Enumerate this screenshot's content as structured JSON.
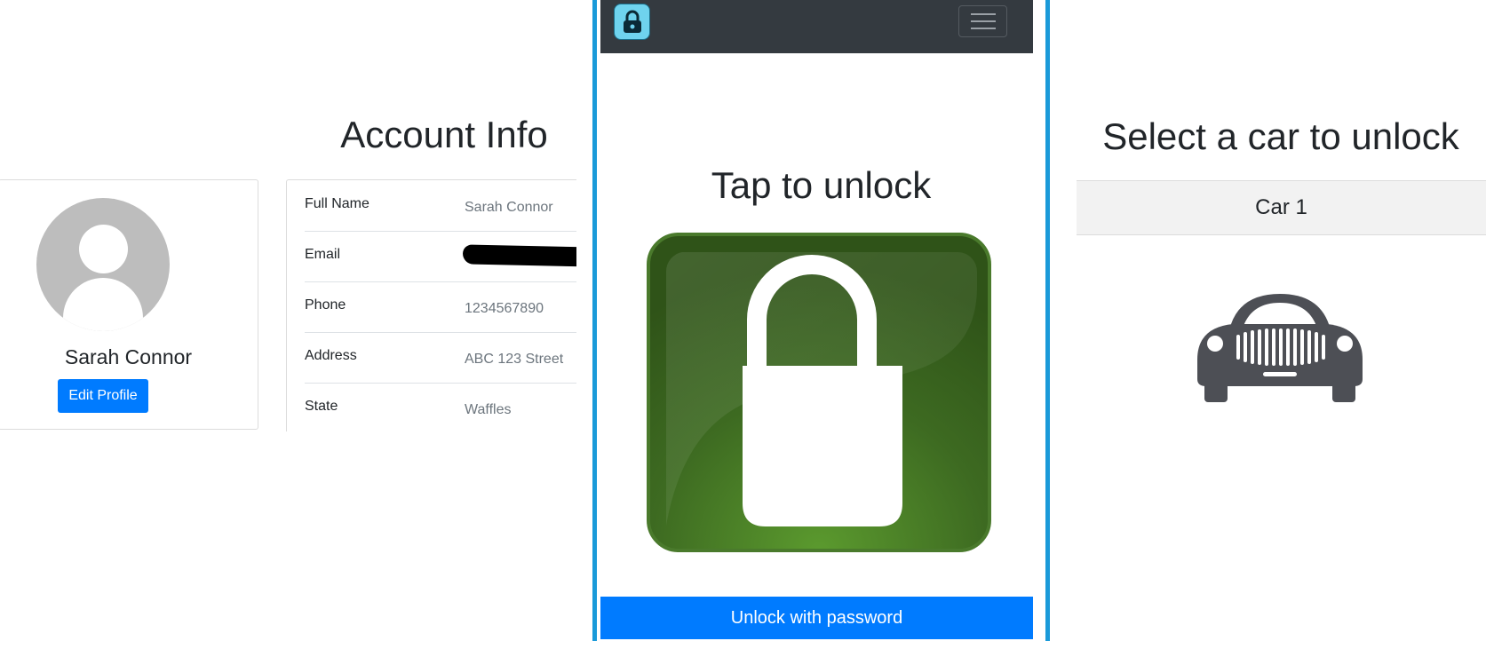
{
  "account": {
    "heading": "Account Info",
    "profile": {
      "name": "Sarah Connor",
      "edit_button": "Edit Profile",
      "avatar_icon": "user-avatar-icon"
    },
    "fields": [
      {
        "label": "Full Name",
        "value": "Sarah Connor"
      },
      {
        "label": "Email",
        "value": ""
      },
      {
        "label": "Phone",
        "value": "1234567890"
      },
      {
        "label": "Address",
        "value": "ABC 123 Street"
      },
      {
        "label": "State",
        "value": "Waffles"
      }
    ]
  },
  "unlock_screen": {
    "logo_icon": "padlock-app-icon",
    "menu_icon": "hamburger-menu-icon",
    "heading": "Tap to unlock",
    "lock_icon": "padlock-icon",
    "password_button": "Unlock with password"
  },
  "car_select": {
    "heading": "Select a car to unlock",
    "cars": [
      {
        "label": "Car 1",
        "icon": "car-icon"
      }
    ]
  },
  "colors": {
    "primary": "#007bff",
    "navbar": "#343a40",
    "phone_frame": "#1a9ad9",
    "lock_green": "#3f6b25",
    "car_icon": "#4d4f55",
    "avatar_gray": "#bdbdbd"
  }
}
